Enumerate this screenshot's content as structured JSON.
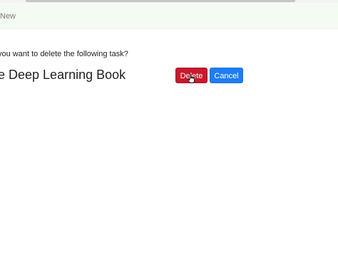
{
  "navbar": {
    "link_label": "New"
  },
  "dialog": {
    "prompt": "you want to delete the following task?",
    "task_title": "e Deep Learning Book",
    "delete_label": "Delete",
    "cancel_label": "Cancel"
  },
  "colors": {
    "delete_button": "#c9192c",
    "cancel_button": "#1e7ef1",
    "navbar_background": "#f4fbf2"
  },
  "icons": {
    "cursor": "hand-pointer-icon"
  }
}
